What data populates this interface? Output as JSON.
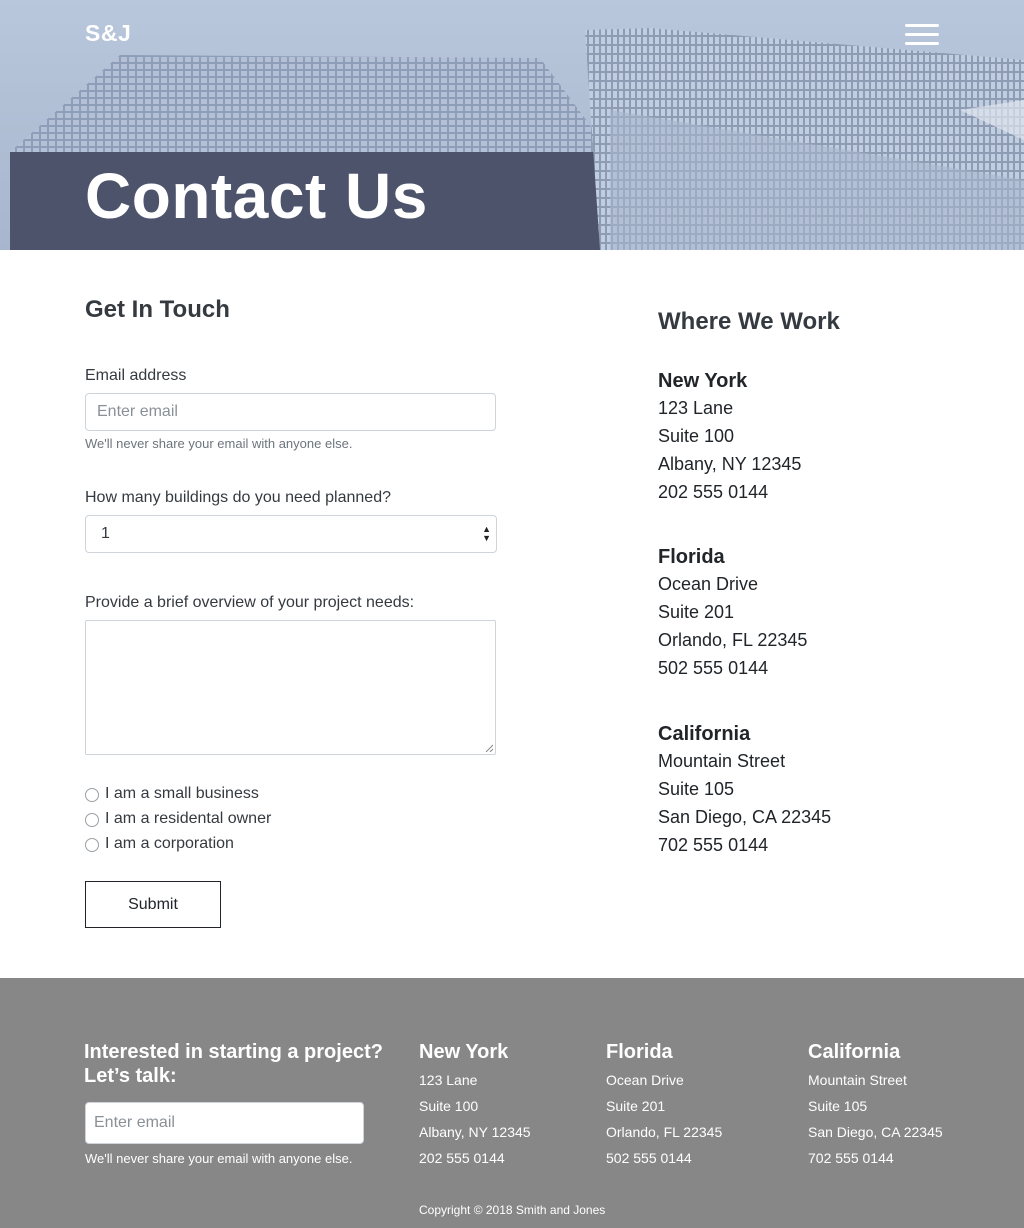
{
  "header": {
    "brand": "S&J",
    "title": "Contact Us"
  },
  "form": {
    "heading": "Get In Touch",
    "email_label": "Email address",
    "email_placeholder": "Enter email",
    "email_help": "We'll never share your email with anyone else.",
    "buildings_label": "How many buildings do you need planned?",
    "buildings_value": "1",
    "overview_label": "Provide a brief overview of your project needs:",
    "radios": [
      {
        "label": "I am a small business"
      },
      {
        "label": "I am a residental owner"
      },
      {
        "label": "I am a corporation"
      }
    ],
    "submit_label": "Submit"
  },
  "offices": {
    "heading": "Where We Work",
    "items": [
      {
        "city": "New York",
        "street": "123 Lane",
        "suite": "Suite 100",
        "citystate": "Albany, NY 12345",
        "phone": "202 555 0144"
      },
      {
        "city": "Florida",
        "street": "Ocean Drive",
        "suite": "Suite 201",
        "citystate": "Orlando, FL 22345",
        "phone": "502 555 0144"
      },
      {
        "city": "California",
        "street": "Mountain Street",
        "suite": "Suite 105",
        "citystate": "San Diego, CA 22345",
        "phone": "702 555 0144"
      }
    ]
  },
  "footer": {
    "cta": "Interested in starting a project? Let’s talk:",
    "email_placeholder": "Enter email",
    "email_help": "We'll never share your email with anyone else.",
    "copyright": "Copyright © 2018 Smith and Jones"
  },
  "icons": {
    "menu": "hamburger-menu-icon",
    "select": "select-arrows-icon"
  },
  "colors": {
    "footer_bg": "#878787",
    "text": "#212529"
  }
}
